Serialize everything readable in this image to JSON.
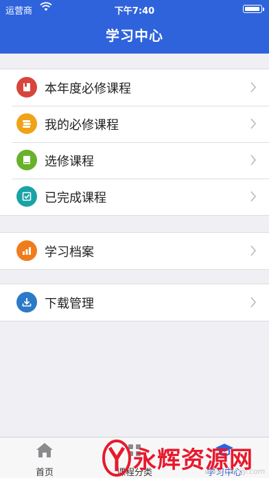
{
  "status_bar": {
    "carrier": "运营商",
    "time": "下午7:40"
  },
  "header": {
    "title": "学习中心"
  },
  "groups": [
    {
      "items": [
        {
          "label": "本年度必修课程",
          "icon": "red-book-icon",
          "color": "#d8453b"
        },
        {
          "label": "我的必修课程",
          "icon": "yellow-books-icon",
          "color": "#f0a318"
        },
        {
          "label": "选修课程",
          "icon": "green-book-icon",
          "color": "#68b22b"
        },
        {
          "label": "已完成课程",
          "icon": "teal-checkbox-icon",
          "color": "#1aa3a6"
        }
      ]
    },
    {
      "items": [
        {
          "label": "学习档案",
          "icon": "orange-chart-icon",
          "color": "#ef7d1c"
        }
      ]
    },
    {
      "items": [
        {
          "label": "下载管理",
          "icon": "blue-download-icon",
          "color": "#2b79c7"
        }
      ]
    }
  ],
  "tabbar": {
    "tabs": [
      {
        "label": "首页",
        "icon": "home-icon"
      },
      {
        "label": "课程分类",
        "icon": "category-icon"
      },
      {
        "label": "学习中心",
        "icon": "study-center-icon",
        "active": true
      }
    ]
  },
  "watermark": {
    "text": "永辉资源网",
    "url": "www.yhkjjy.com"
  },
  "colors": {
    "header_bg": "#2f63dc",
    "page_bg": "#efeff4",
    "watermark_red": "#e8192c"
  }
}
